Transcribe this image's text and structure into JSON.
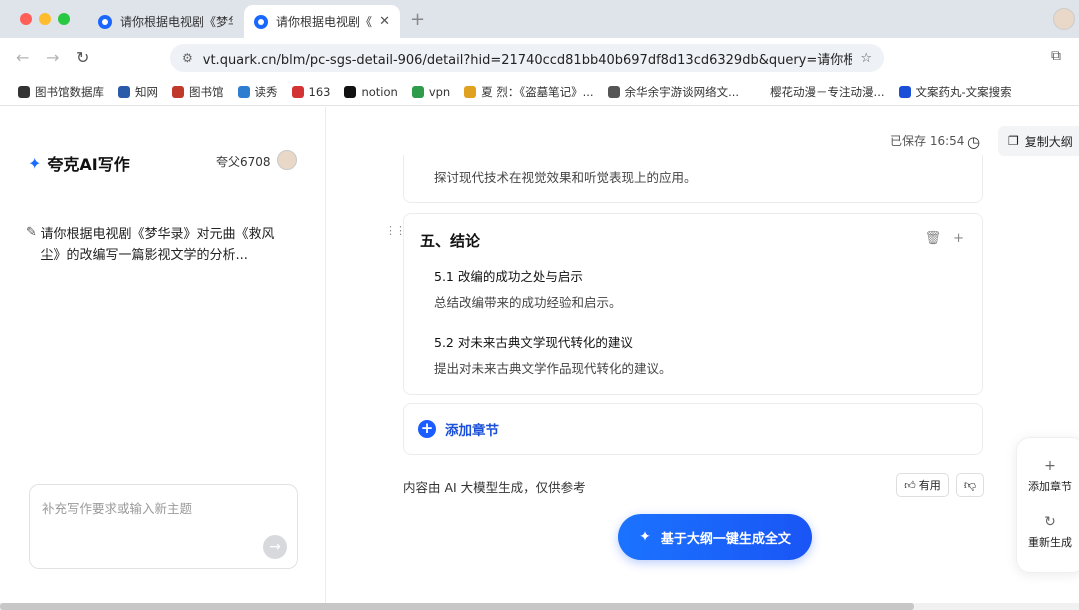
{
  "browser": {
    "tabs": [
      {
        "title": "请你根据电视剧《梦华",
        "active": false
      },
      {
        "title": "请你根据电视剧《",
        "active": true
      }
    ],
    "new_tab_symbol": "+",
    "url": "vt.quark.cn/blm/pc-sgs-detail-906/detail?hid=21740ccd81bb40b697df8d13cd6329db&query=请你根...",
    "bookmarks": [
      {
        "label": "图书馆数据库",
        "color": "#333333"
      },
      {
        "label": "知网",
        "color": "#2b5aa8"
      },
      {
        "label": "图书馆",
        "color": "#c0392b"
      },
      {
        "label": "读秀",
        "color": "#2e7dd1"
      },
      {
        "label": "163",
        "color": "#d33333"
      },
      {
        "label": "notion",
        "color": "#111111"
      },
      {
        "label": "vpn",
        "color": "#2e9c4a"
      },
      {
        "label": "夏 烈：《盗墓笔记》...",
        "color": "#e0a020"
      },
      {
        "label": "余华余宇游谈网络文...",
        "color": "#555555"
      },
      {
        "label": "樱花动漫－专注动漫...",
        "color": "#ffffff"
      },
      {
        "label": "文案药丸-文案搜索",
        "color": "#1a4fd8"
      }
    ]
  },
  "sidebar": {
    "brand": "夸克AI写作",
    "username": "夸父6708",
    "history": [
      {
        "text": "请你根据电视剧《梦华录》对元曲《救风尘》的改编写一篇影视文学的分析..."
      }
    ],
    "input_placeholder": "补充写作要求或输入新主题"
  },
  "toolbar": {
    "saved_status": "已保存 16:54",
    "copy_outline_label": "复制大纲"
  },
  "outline": {
    "prev_section_desc": "探讨现代技术在视觉效果和听觉表现上的应用。",
    "section": {
      "title": "五、结论",
      "subsections": [
        {
          "title": "5.1 改编的成功之处与启示",
          "desc": "总结改编带来的成功经验和启示。"
        },
        {
          "title": "5.2 对未来古典文学现代转化的建议",
          "desc": "提出对未来古典文学作品现代转化的建议。"
        }
      ]
    },
    "add_chapter_label": "添加章节"
  },
  "footer": {
    "disclaimer": "内容由 AI 大模型生成，仅供参考",
    "useful_label": "有用",
    "generate_label": "基于大纲一键生成全文"
  },
  "float_panel": {
    "add_chapter_label": "添加章节",
    "regenerate_label": "重新生成"
  },
  "colors": {
    "accent": "#1a5cff",
    "generate_gradient_start": "#1b73ff",
    "generate_gradient_end": "#1a55f5"
  }
}
